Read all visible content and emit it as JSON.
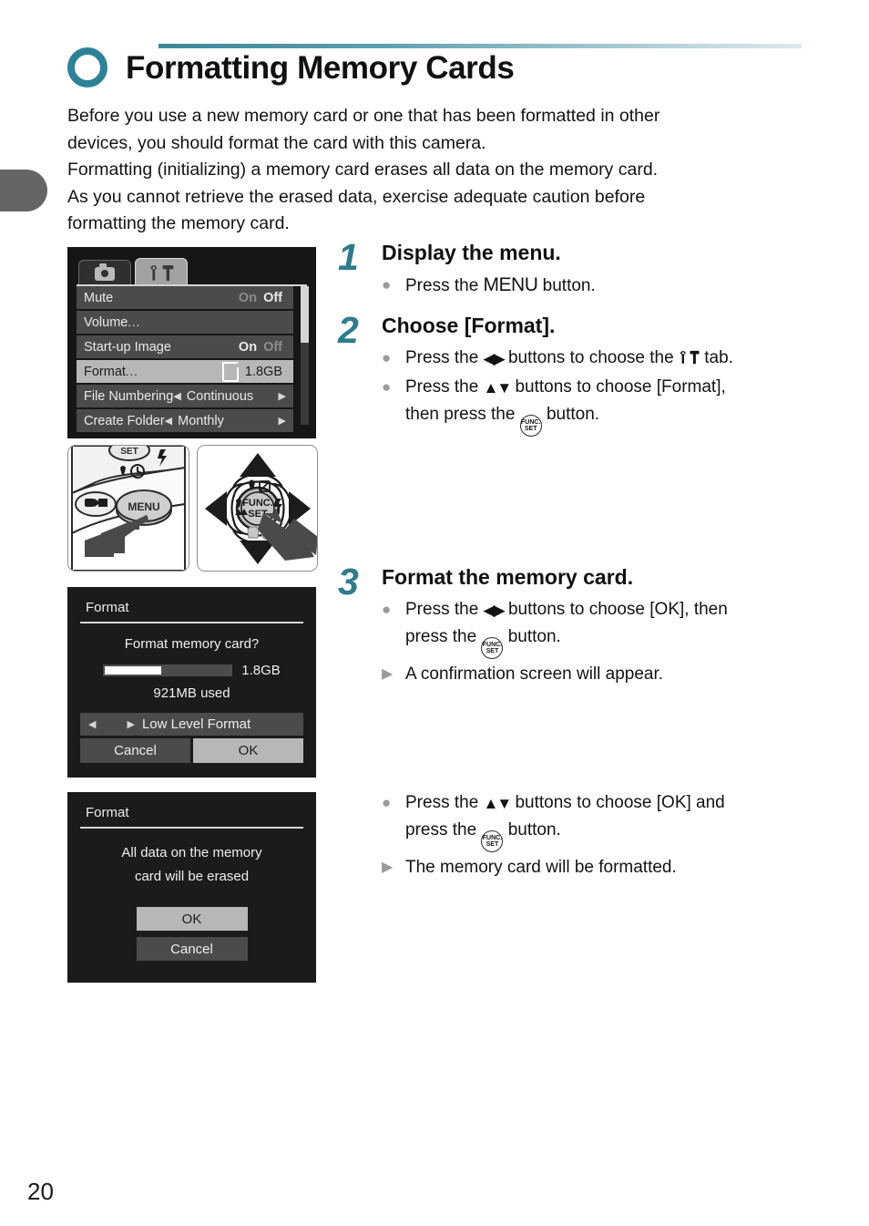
{
  "page": {
    "number": "20",
    "chapter_tab": ""
  },
  "header": {
    "icon": "teal-ring-icon",
    "title": "Formatting Memory Cards",
    "accent_color": "#2e8298"
  },
  "intro": {
    "line1": "Before you use a new memory card or one that has been formatted in other",
    "line2": "devices, you should format the card with this camera.",
    "line3": "Formatting (initializing) a memory card erases all data on the memory card.",
    "line4": "As you cannot retrieve the erased data, exercise adequate caution before",
    "line5": "formatting the memory card."
  },
  "lcd_menu": {
    "tabs": [
      {
        "name": "camera-tab",
        "icon": "camera-icon",
        "active": false
      },
      {
        "name": "settings-tab",
        "icon": "wrench-hammer-icon",
        "active": true
      }
    ],
    "rows": [
      {
        "label": "Mute",
        "type": "onoff",
        "on": "On",
        "off": "Off",
        "selected_value": "Off"
      },
      {
        "label": "Volume",
        "ellipsis": "...",
        "type": "plain"
      },
      {
        "label": "Start-up Image",
        "type": "onoff",
        "on": "On",
        "off": "Off",
        "selected_value": "On"
      },
      {
        "label": "Format",
        "ellipsis": "...",
        "type": "card",
        "value": "1.8GB",
        "highlighted": true
      },
      {
        "label": "File Numbering",
        "type": "arrows",
        "value": "Continuous"
      },
      {
        "label": "Create Folder",
        "type": "arrows",
        "value": "Monthly"
      }
    ]
  },
  "button_figures": [
    {
      "name": "menu-button-photo",
      "caption": "MENU"
    },
    {
      "name": "direction-pad-photo",
      "caption": "FUNC. SET"
    }
  ],
  "format_dialog": {
    "title": "Format",
    "question": "Format memory card?",
    "capacity": "1.8GB",
    "used": "921MB used",
    "meter_percent": 45,
    "option": "Low Level Format",
    "buttons": [
      {
        "label": "Cancel",
        "selected": false
      },
      {
        "label": "OK",
        "selected": true
      }
    ]
  },
  "confirm_dialog": {
    "title": "Format",
    "message_line1": "All data on the memory",
    "message_line2": "card will be erased",
    "buttons": [
      {
        "label": "OK",
        "selected": true
      },
      {
        "label": "Cancel",
        "selected": false
      }
    ]
  },
  "steps": [
    {
      "number": "1",
      "heading": "Display the menu.",
      "bullets": [
        {
          "marker": "dot",
          "pre": "Press the ",
          "key": "MENU",
          "post": " button."
        }
      ]
    },
    {
      "number": "2",
      "heading": "Choose [Format].",
      "bullets": [
        {
          "marker": "dot",
          "pre": "Press the ",
          "key": "◀▶",
          "mid": " buttons to choose the ",
          "post": " tab.",
          "trailing_icon": "wrench-hammer-icon"
        },
        {
          "marker": "dot",
          "pre": "Press the ",
          "key": "▲▼",
          "post": " buttons to choose [Format],",
          "second_line_pre": "then press the ",
          "second_line_post": " button.",
          "inline_icon": "func-set-button-icon"
        }
      ]
    },
    {
      "number": "3",
      "heading": "Format the memory card.",
      "bullets": [
        {
          "marker": "dot",
          "pre": "Press the ",
          "key": "◀▶",
          "post": " buttons to choose [OK], then",
          "second_line_pre": "press the ",
          "second_line_post": " button.",
          "inline_icon": "func-set-button-icon"
        },
        {
          "marker": "triangle",
          "pre": "A confirmation screen will appear."
        }
      ]
    }
  ],
  "final_bullets": [
    {
      "marker": "dot",
      "pre": "Press the ",
      "key": "▲▼",
      "post": " buttons to choose [OK] and",
      "second_line_pre": "press the ",
      "second_line_post": " button.",
      "inline_icon": "func-set-button-icon"
    },
    {
      "marker": "triangle",
      "pre": "The memory card will be formatted."
    }
  ],
  "markers": {
    "dot": "●",
    "triangle": "▶"
  },
  "func_button": {
    "top": "FUNC.",
    "bottom": "SET"
  }
}
